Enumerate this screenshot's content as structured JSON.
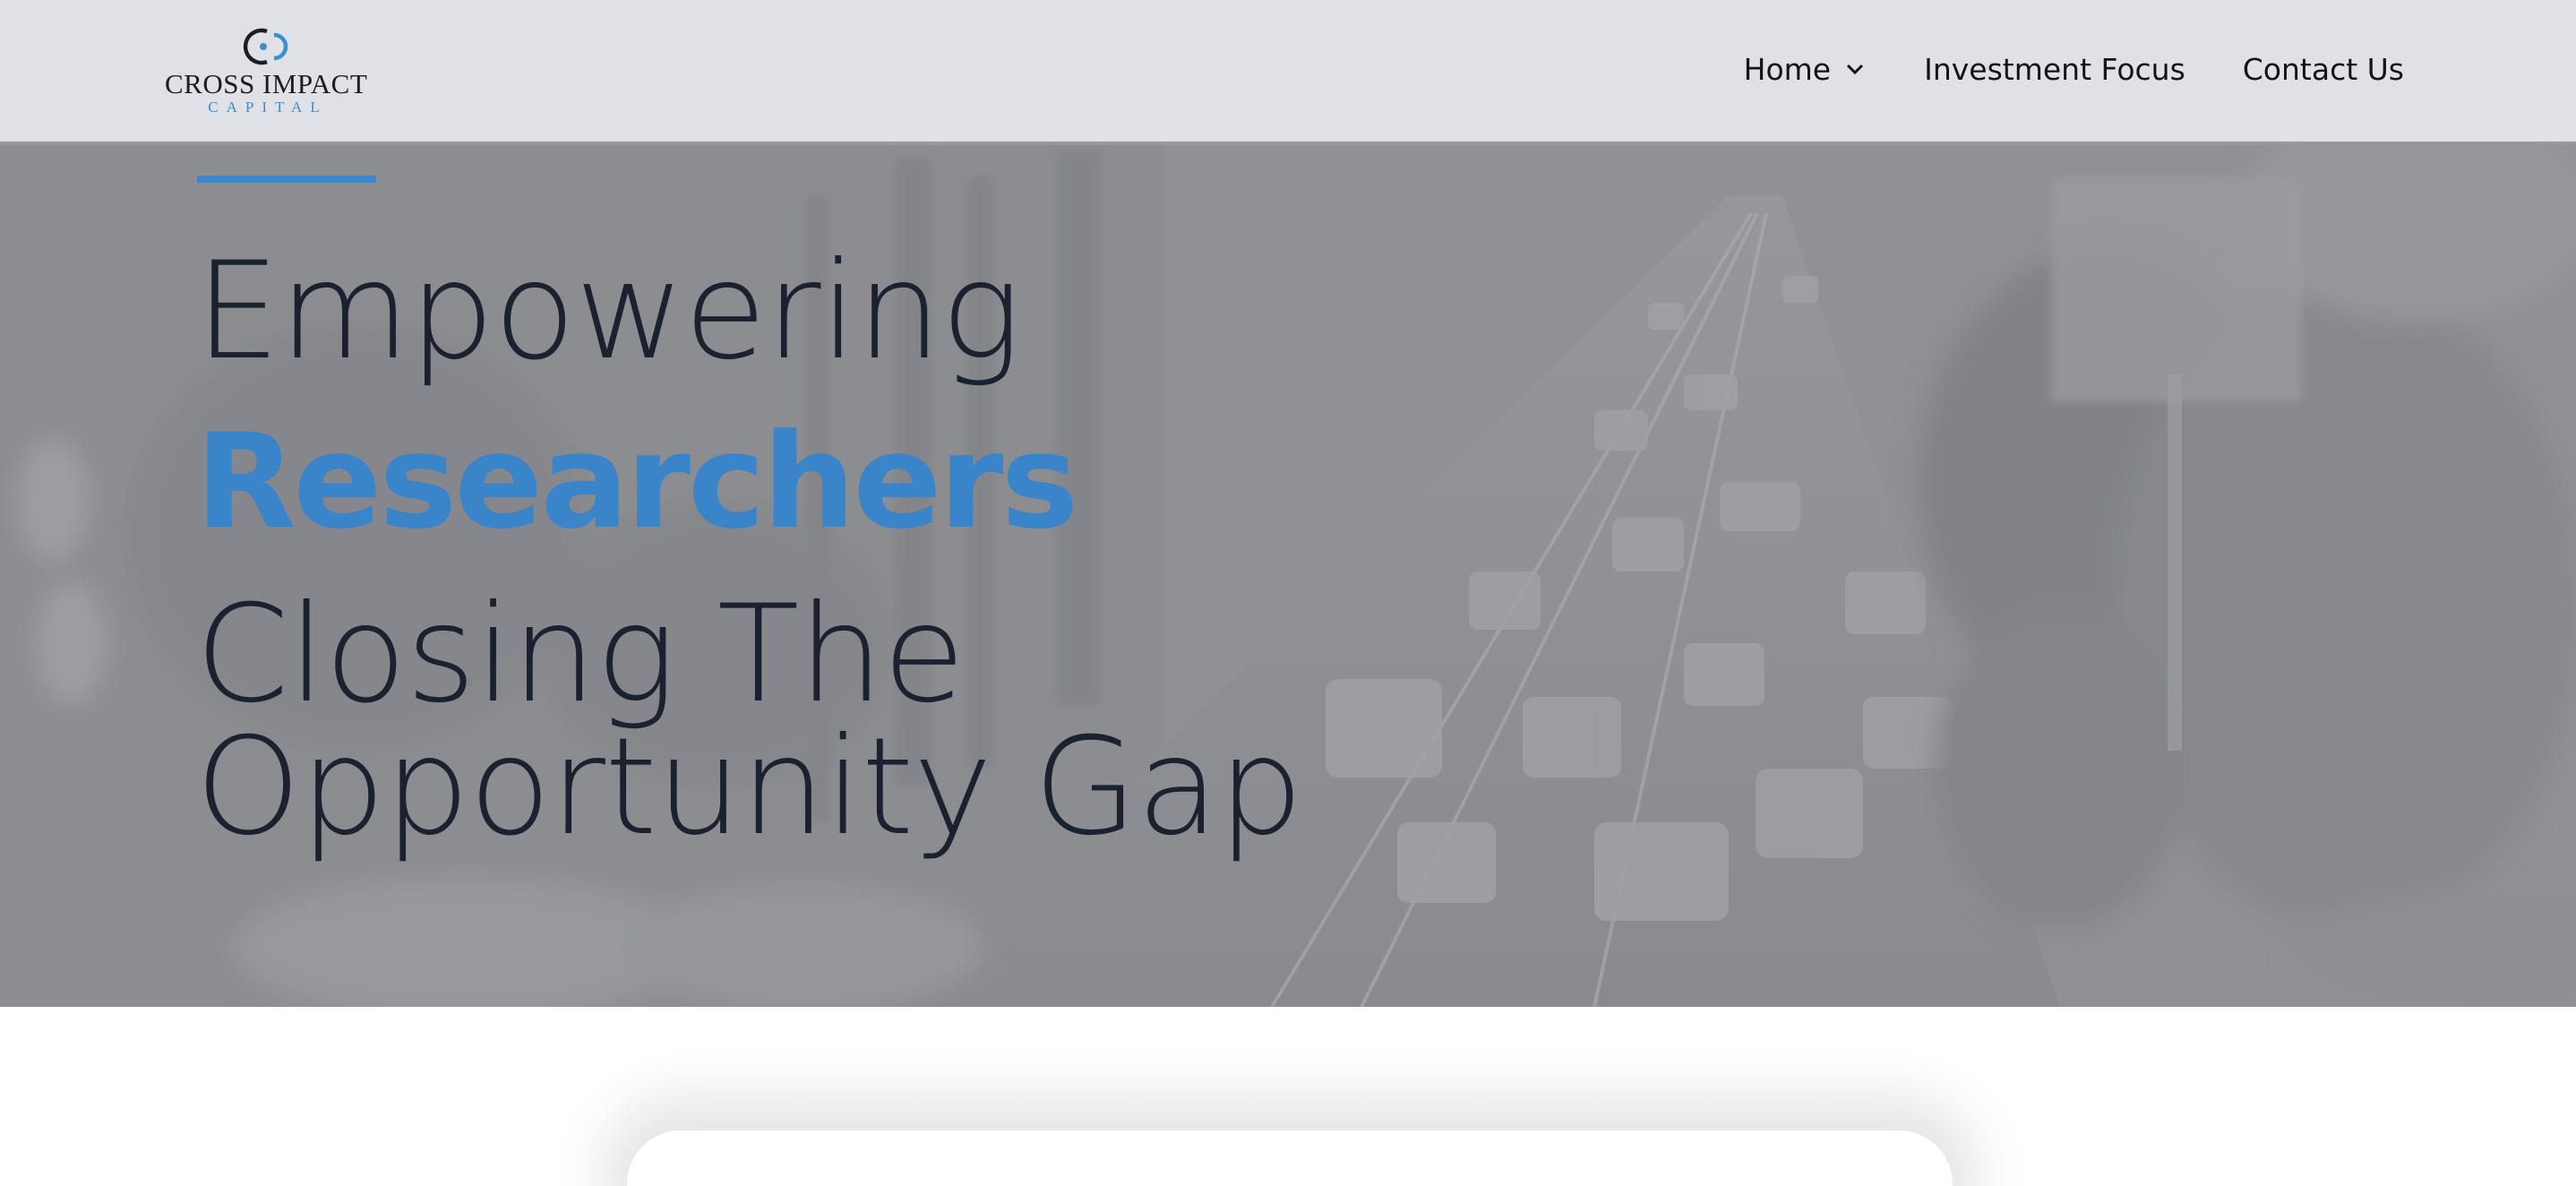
{
  "header": {
    "logo": {
      "name": "CROSS IMPACT",
      "subtitle": "CAPITAL",
      "icon": "cross-impact-logo-mark"
    },
    "nav": {
      "home_label": "Home",
      "home_icon": "chevron-down-icon",
      "investment_label": "Investment Focus",
      "contact_label": "Contact Us"
    }
  },
  "hero": {
    "line1": "Empowering",
    "line2": "Researchers",
    "line3": "Closing The",
    "line4": "Opportunity Gap",
    "background": "blurred-city-street-at-night"
  },
  "colors": {
    "accent": "#3b86cc",
    "header_bg": "#dfe1e6",
    "heading": "#1c2130"
  }
}
